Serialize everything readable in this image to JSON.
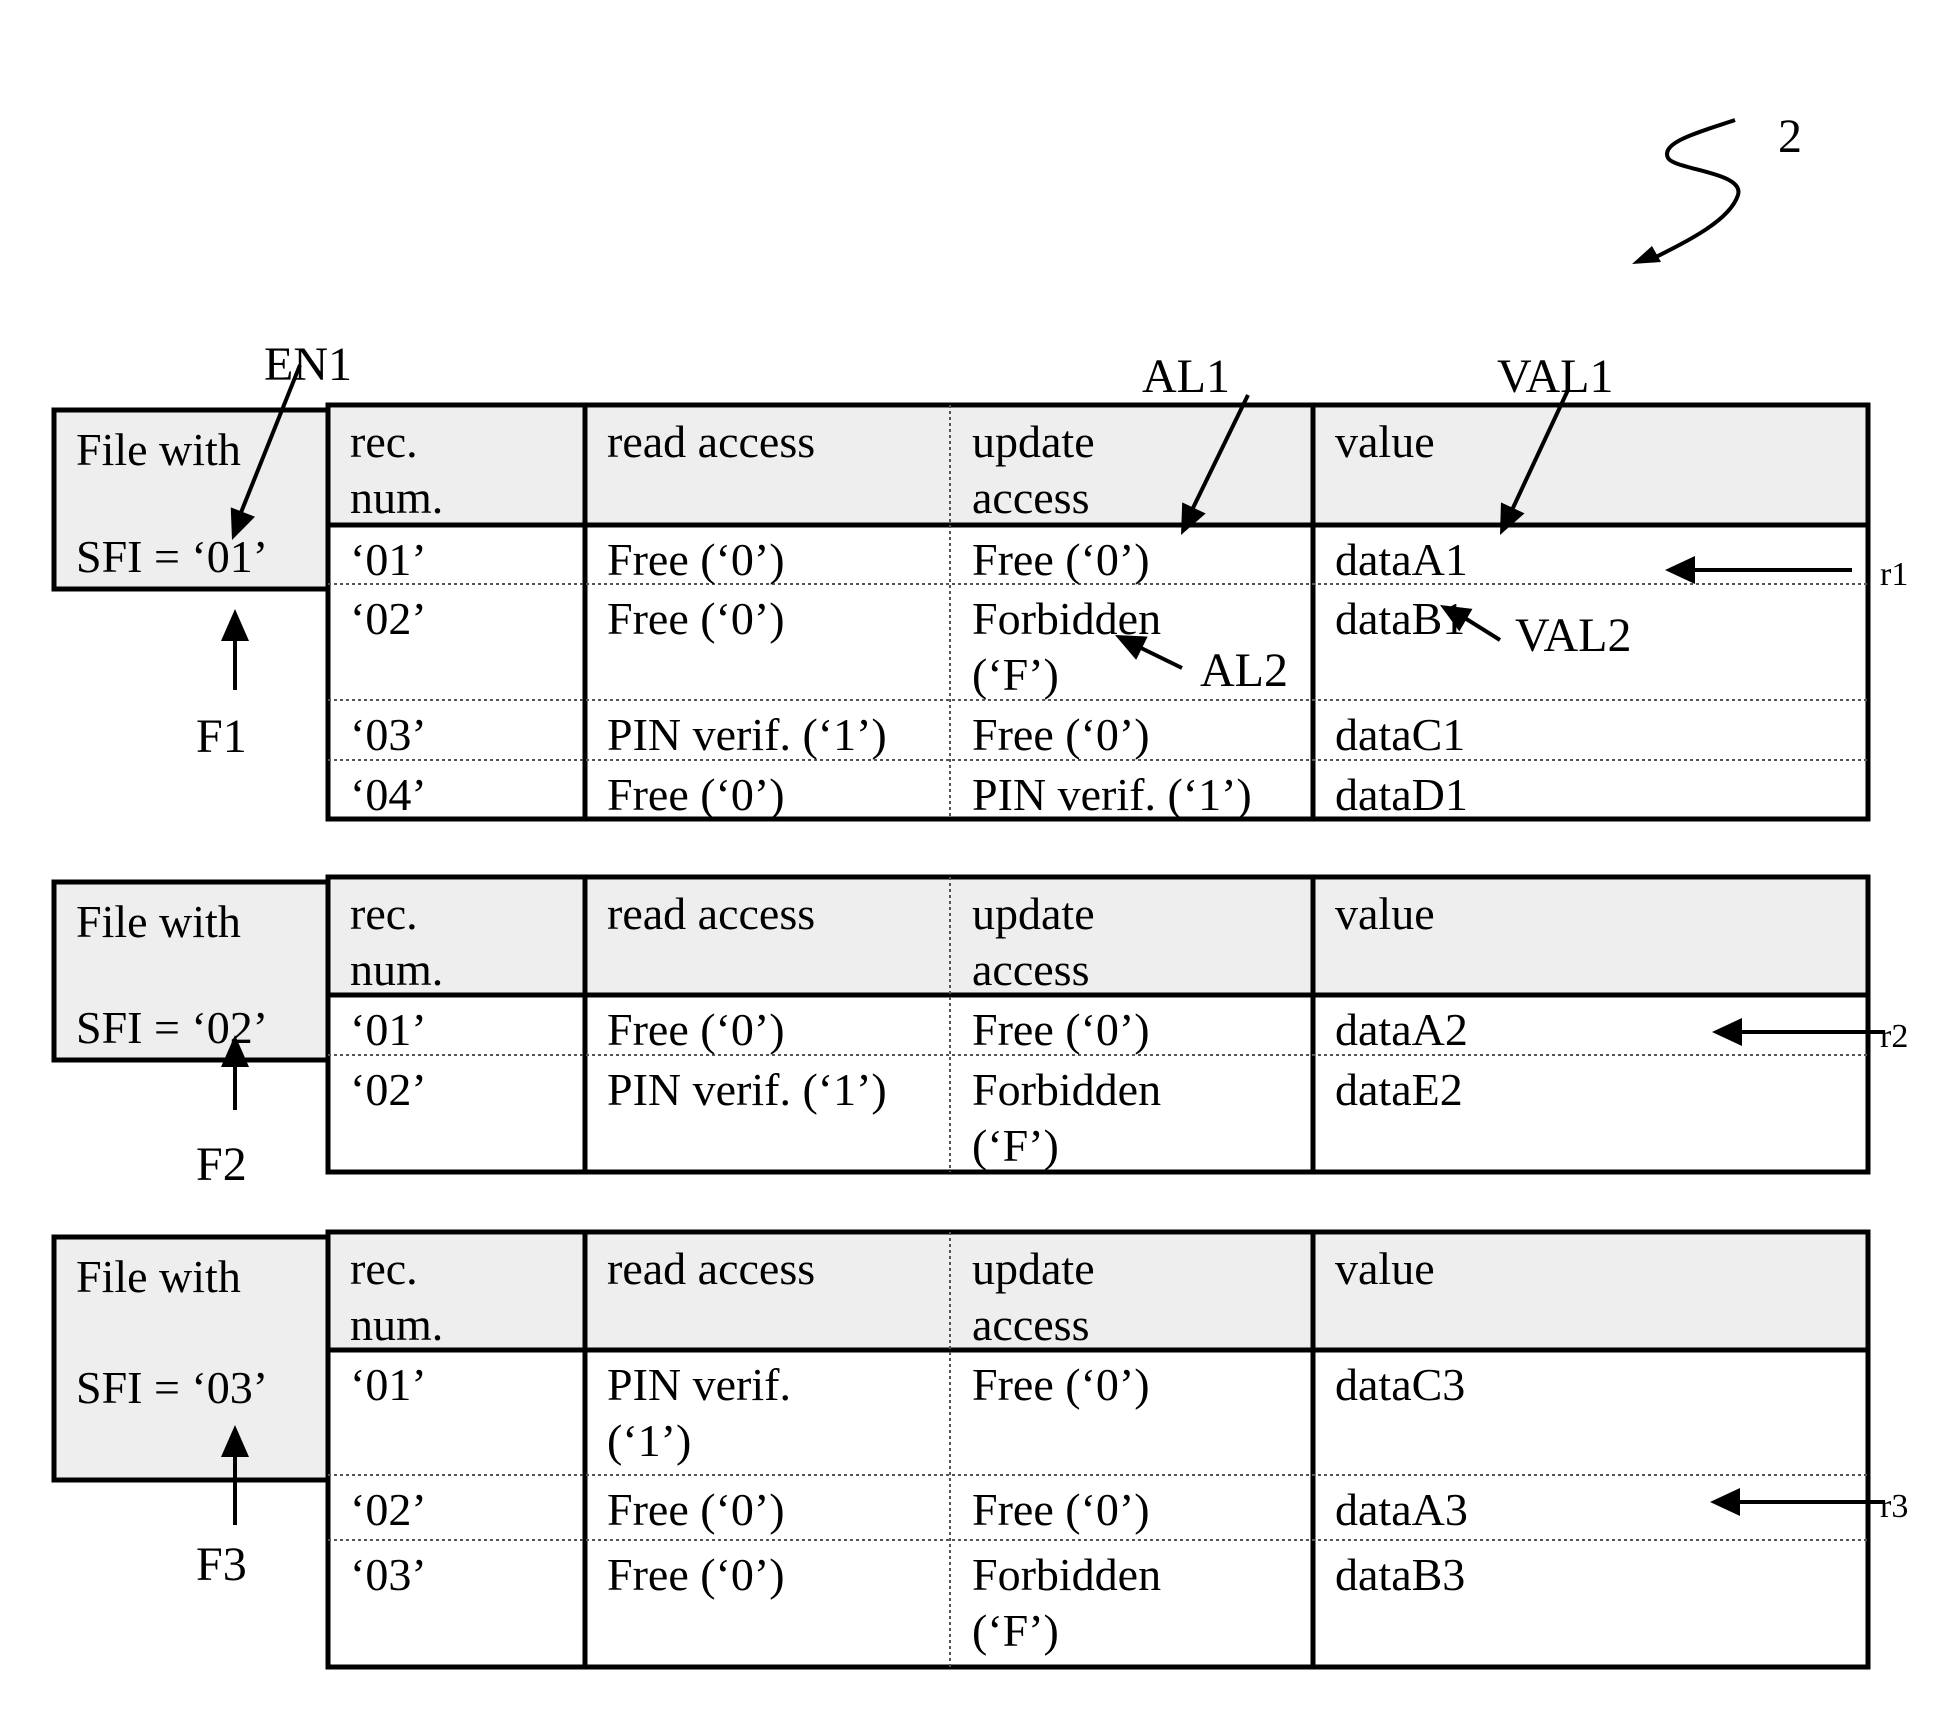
{
  "figure_ref": "2",
  "columns": [
    "rec.\nnum.",
    "read access",
    "update\naccess",
    "value"
  ],
  "column_lines": {
    "rec": [
      "rec.",
      "num."
    ],
    "read": [
      "read access"
    ],
    "update": [
      "update",
      "access"
    ],
    "value": [
      "value"
    ]
  },
  "files": [
    {
      "label_line1": "File with",
      "label_line2": "SFI = ‘01’",
      "ref": "F1",
      "row_ref": "r1",
      "rows": [
        {
          "rec": "‘01’",
          "read": [
            "Free (‘0’)"
          ],
          "update": [
            "Free (‘0’)"
          ],
          "value": "dataA1"
        },
        {
          "rec": "‘02’",
          "read": [
            "Free (‘0’)"
          ],
          "update": [
            "Forbidden",
            "(‘F’)"
          ],
          "value": "dataB1"
        },
        {
          "rec": "‘03’",
          "read": [
            "PIN verif. (‘1’)"
          ],
          "update": [
            "Free (‘0’)"
          ],
          "value": "dataC1"
        },
        {
          "rec": "‘04’",
          "read": [
            "Free (‘0’)"
          ],
          "update": [
            "PIN verif. (‘1’)"
          ],
          "value": "dataD1"
        }
      ]
    },
    {
      "label_line1": "File with",
      "label_line2": "SFI = ‘02’",
      "ref": "F2",
      "row_ref": "r2",
      "rows": [
        {
          "rec": "‘01’",
          "read": [
            "Free (‘0’)"
          ],
          "update": [
            "Free (‘0’)"
          ],
          "value": "dataA2"
        },
        {
          "rec": "‘02’",
          "read": [
            "PIN verif. (‘1’)"
          ],
          "update": [
            "Forbidden",
            "(‘F’)"
          ],
          "value": "dataE2"
        }
      ]
    },
    {
      "label_line1": "File with",
      "label_line2": "SFI = ‘03’",
      "ref": "F3",
      "row_ref": "r3",
      "rows": [
        {
          "rec": "‘01’",
          "read": [
            "PIN verif.",
            "(‘1’)"
          ],
          "update": [
            "Free (‘0’)"
          ],
          "value": "dataC3"
        },
        {
          "rec": "‘02’",
          "read": [
            "Free (‘0’)"
          ],
          "update": [
            "Free (‘0’)"
          ],
          "value": "dataA3"
        },
        {
          "rec": "‘03’",
          "read": [
            "Free (‘0’)"
          ],
          "update": [
            "Forbidden",
            "(‘F’)"
          ],
          "value": "dataB3"
        }
      ]
    }
  ],
  "annotations": {
    "en1": "EN1",
    "al1": "AL1",
    "val1": "VAL1",
    "al2": "AL2",
    "val2": "VAL2"
  }
}
